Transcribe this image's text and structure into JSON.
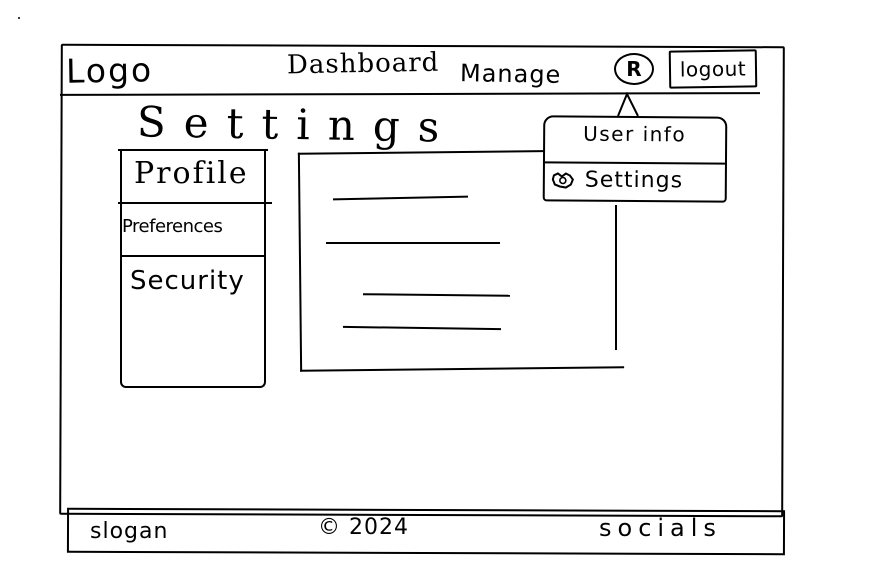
{
  "header": {
    "logo_text": "Logo",
    "nav": [
      {
        "label": "Dashboard"
      },
      {
        "label": "Manage"
      }
    ],
    "avatar_glyph": "R",
    "logout_label": "logout"
  },
  "page": {
    "title": "Settings"
  },
  "sidebar": {
    "items": [
      {
        "label": "Profile"
      },
      {
        "label": "Preferences"
      },
      {
        "label": "Security"
      }
    ]
  },
  "dropdown": {
    "user_info_label": "User info",
    "settings_label": "Settings",
    "settings_icon": "gear-icon"
  },
  "footer": {
    "slogan": "slogan",
    "copyright": "© 2024",
    "socials": "socials"
  }
}
